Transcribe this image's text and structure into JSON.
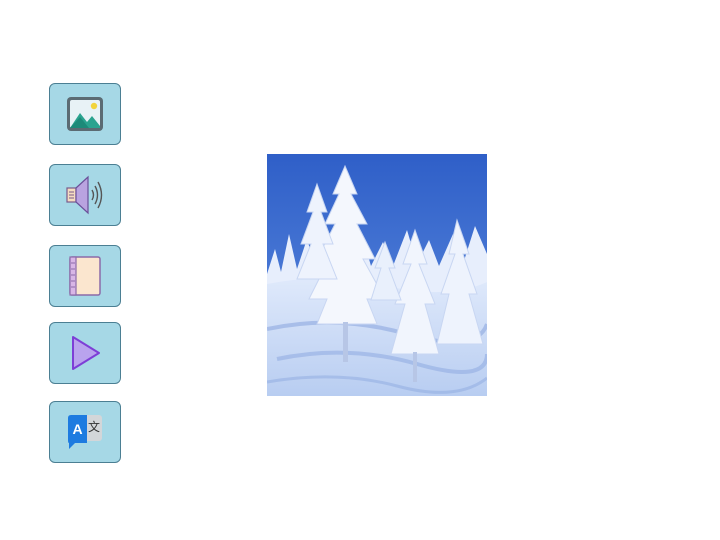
{
  "toolbar": {
    "items": [
      {
        "name": "image-button",
        "icon": "image-icon"
      },
      {
        "name": "audio-button",
        "icon": "speaker-icon"
      },
      {
        "name": "notebook-button",
        "icon": "notebook-icon"
      },
      {
        "name": "play-button",
        "icon": "play-icon"
      },
      {
        "name": "translate-button",
        "icon": "translate-icon",
        "glyphs": [
          "A",
          "文"
        ]
      }
    ]
  },
  "photo": {
    "subject": "snow-covered-pine-forest"
  },
  "colors": {
    "button_bg": "#a6d8e6",
    "button_border": "#4b7f93",
    "sky": "#3f6fd0"
  }
}
